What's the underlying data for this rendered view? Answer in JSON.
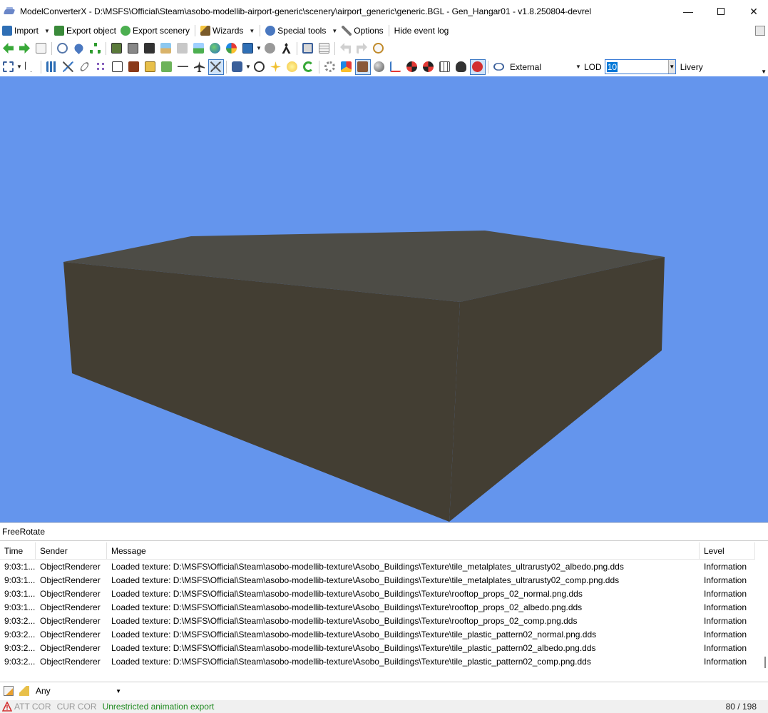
{
  "window": {
    "title": "ModelConverterX - D:\\MSFS\\Official\\Steam\\asobo-modellib-airport-generic\\scenery\\airport_generic\\generic.BGL - Gen_Hangar01 - v1.8.250804-devrel",
    "min_glyph": "—",
    "close_glyph": "✕"
  },
  "menu": {
    "import": "Import",
    "export_object": "Export object",
    "export_scenery": "Export scenery",
    "wizards": "Wizards",
    "special_tools": "Special tools",
    "options": "Options",
    "hide_event_log": "Hide event log"
  },
  "toolbar2": {
    "view_mode": "External",
    "lod_label": "LOD",
    "lod_value": "10",
    "livery_label": "Livery"
  },
  "colors": {
    "sky": "#6495ed",
    "box_front": "#433e33",
    "box_top": "#4d4c46"
  },
  "mode": {
    "label": "FreeRotate"
  },
  "log": {
    "headers": {
      "time": "Time",
      "sender": "Sender",
      "message": "Message",
      "level": "Level"
    },
    "rows": [
      {
        "time": "9:03:1...",
        "sender": "ObjectRenderer",
        "message": "Loaded texture: D:\\MSFS\\Official\\Steam\\asobo-modellib-texture\\Asobo_Buildings\\Texture\\tile_metalplates_ultrarusty02_albedo.png.dds",
        "level": "Information"
      },
      {
        "time": "9:03:1...",
        "sender": "ObjectRenderer",
        "message": "Loaded texture: D:\\MSFS\\Official\\Steam\\asobo-modellib-texture\\Asobo_Buildings\\Texture\\tile_metalplates_ultrarusty02_comp.png.dds",
        "level": "Information"
      },
      {
        "time": "9:03:1...",
        "sender": "ObjectRenderer",
        "message": "Loaded texture: D:\\MSFS\\Official\\Steam\\asobo-modellib-texture\\Asobo_Buildings\\Texture\\rooftop_props_02_normal.png.dds",
        "level": "Information"
      },
      {
        "time": "9:03:1...",
        "sender": "ObjectRenderer",
        "message": "Loaded texture: D:\\MSFS\\Official\\Steam\\asobo-modellib-texture\\Asobo_Buildings\\Texture\\rooftop_props_02_albedo.png.dds",
        "level": "Information"
      },
      {
        "time": "9:03:2...",
        "sender": "ObjectRenderer",
        "message": "Loaded texture: D:\\MSFS\\Official\\Steam\\asobo-modellib-texture\\Asobo_Buildings\\Texture\\rooftop_props_02_comp.png.dds",
        "level": "Information"
      },
      {
        "time": "9:03:2...",
        "sender": "ObjectRenderer",
        "message": "Loaded texture: D:\\MSFS\\Official\\Steam\\asobo-modellib-texture\\Asobo_Buildings\\Texture\\tile_plastic_pattern02_normal.png.dds",
        "level": "Information"
      },
      {
        "time": "9:03:2...",
        "sender": "ObjectRenderer",
        "message": "Loaded texture: D:\\MSFS\\Official\\Steam\\asobo-modellib-texture\\Asobo_Buildings\\Texture\\tile_plastic_pattern02_albedo.png.dds",
        "level": "Information"
      },
      {
        "time": "9:03:2...",
        "sender": "ObjectRenderer",
        "message": "Loaded texture: D:\\MSFS\\Official\\Steam\\asobo-modellib-texture\\Asobo_Buildings\\Texture\\tile_plastic_pattern02_comp.png.dds",
        "level": "Information"
      }
    ]
  },
  "filter": {
    "selected": "Any"
  },
  "status": {
    "att_cor": "ATT COR",
    "cur_cor": "CUR COR",
    "message": "Unrestricted animation export",
    "count": "80 / 198"
  }
}
